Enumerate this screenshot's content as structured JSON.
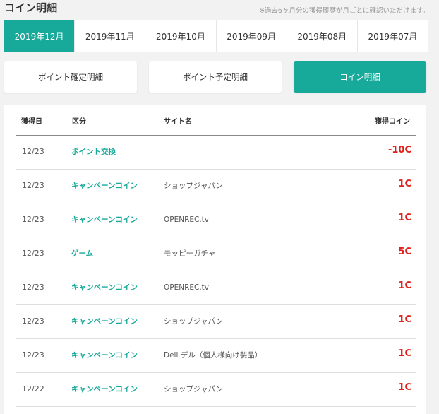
{
  "page": {
    "title": "コイン明細",
    "note": "※過去6ヶ月分の獲得履歴が月ごとに確認いただけます。"
  },
  "months": [
    {
      "label": "2019年12月",
      "active": true
    },
    {
      "label": "2019年11月",
      "active": false
    },
    {
      "label": "2019年10月",
      "active": false
    },
    {
      "label": "2019年09月",
      "active": false
    },
    {
      "label": "2019年08月",
      "active": false
    },
    {
      "label": "2019年07月",
      "active": false
    }
  ],
  "types": [
    {
      "label": "ポイント確定明細",
      "active": false
    },
    {
      "label": "ポイント予定明細",
      "active": false
    },
    {
      "label": "コイン明細",
      "active": true
    }
  ],
  "table": {
    "headers": {
      "date": "獲得日",
      "kind": "区分",
      "site": "サイト名",
      "coin": "獲得コイン"
    },
    "rows": [
      {
        "date": "12/23",
        "kind": "ポイント交換",
        "site": "",
        "coin": "-10C"
      },
      {
        "date": "12/23",
        "kind": "キャンペーンコイン",
        "site": "ショップジャパン",
        "coin": "1C"
      },
      {
        "date": "12/23",
        "kind": "キャンペーンコイン",
        "site": "OPENREC.tv",
        "coin": "1C"
      },
      {
        "date": "12/23",
        "kind": "ゲーム",
        "site": "モッピーガチャ",
        "coin": "5C"
      },
      {
        "date": "12/23",
        "kind": "キャンペーンコイン",
        "site": "OPENREC.tv",
        "coin": "1C"
      },
      {
        "date": "12/23",
        "kind": "キャンペーンコイン",
        "site": "ショップジャパン",
        "coin": "1C"
      },
      {
        "date": "12/23",
        "kind": "キャンペーンコイン",
        "site": "Dell デル（個人様向け製品）",
        "coin": "1C"
      },
      {
        "date": "12/22",
        "kind": "キャンペーンコイン",
        "site": "ショップジャパン",
        "coin": "1C"
      }
    ]
  },
  "colors": {
    "accent": "#17a99a",
    "coin": "#e0201b",
    "background": "#f2f2f2"
  }
}
